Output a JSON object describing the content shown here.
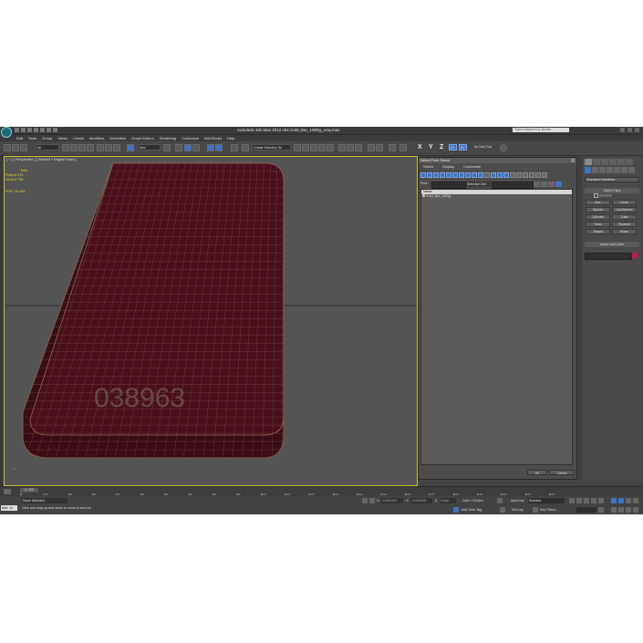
{
  "app": {
    "title": "Autodesk 3ds Max  2012 x64    Gold_Bar_1000g_vray.max",
    "search_placeholder": "Type a keyword or phrase"
  },
  "menu": [
    "Edit",
    "Tools",
    "Group",
    "Views",
    "Create",
    "Modifiers",
    "Animation",
    "Graph Editors",
    "Rendering",
    "Customize",
    "MAXScript",
    "Help"
  ],
  "toolbar": {
    "filter_select": "All",
    "view_select": "View",
    "selection_set_select": "Create Selection Se",
    "axis_x": "X",
    "axis_y": "Y",
    "axis_z": "Z",
    "axis_xy": "XY",
    "axis_xy2": "XY",
    "cam_tool": "ity Cam Tool"
  },
  "viewport": {
    "label": "[ + ] [ Perspective ] [ Shaded + Edged Faces ]",
    "stats_header": "Total",
    "polys_label": "Polys:",
    "polys_value": "8 472",
    "verts_label": "Verts:",
    "verts_value": "2 738",
    "fps_label": "FPS:",
    "fps_value": "29.466",
    "engraving": "038963"
  },
  "scene_explorer": {
    "title": "Select From Scene",
    "menu": [
      "Select",
      "Display",
      "Customize"
    ],
    "find_label": "Find:",
    "selection_set": "Selection Set:",
    "column_header": "Name",
    "rows": [
      "Gold_Bar_1000g"
    ],
    "ok": "OK",
    "cancel": "Cancel"
  },
  "command_panel": {
    "dropdown": "Standard Primitives",
    "object_type": "Object Type",
    "autogrid": "AutoGrid",
    "primitives": [
      "Box",
      "Cone",
      "Sphere",
      "GeoSphere",
      "Cylinder",
      "Tube",
      "Torus",
      "Pyramid",
      "Teapot",
      "Plane"
    ],
    "name_and_color": "Name and Color"
  },
  "timeline": {
    "slider": "0 / 225",
    "ticks": [
      "0",
      "10",
      "20",
      "30",
      "40",
      "50",
      "60",
      "70",
      "80",
      "90",
      "100",
      "110",
      "120",
      "130",
      "140",
      "150",
      "160",
      "170",
      "180",
      "190",
      "200",
      "210",
      "220"
    ]
  },
  "status": {
    "maxscript": "Max. to",
    "selection": "None Selected",
    "prompt": "Click and drag up-and-down to zoom in and out",
    "x_label": "X:",
    "x_value": "-0.000.000",
    "y_label": "Y:",
    "y_value": "-0.000.000",
    "z_label": "Z:",
    "z_value": "0.0cm",
    "grid": "Grid = 10,0cm",
    "autokey": "Auto Key",
    "setkey": "Set Key",
    "selected": "Selected",
    "keyfilters": "Key Filters...",
    "addtimetag": "Add Time Tag"
  },
  "colors": {
    "mesh_fill": "#3a0c16",
    "wire": "#8a6b57",
    "viewport_bg": "#545454",
    "stats_text": "#e6d21a",
    "selection_blue": "#3d72c4"
  }
}
